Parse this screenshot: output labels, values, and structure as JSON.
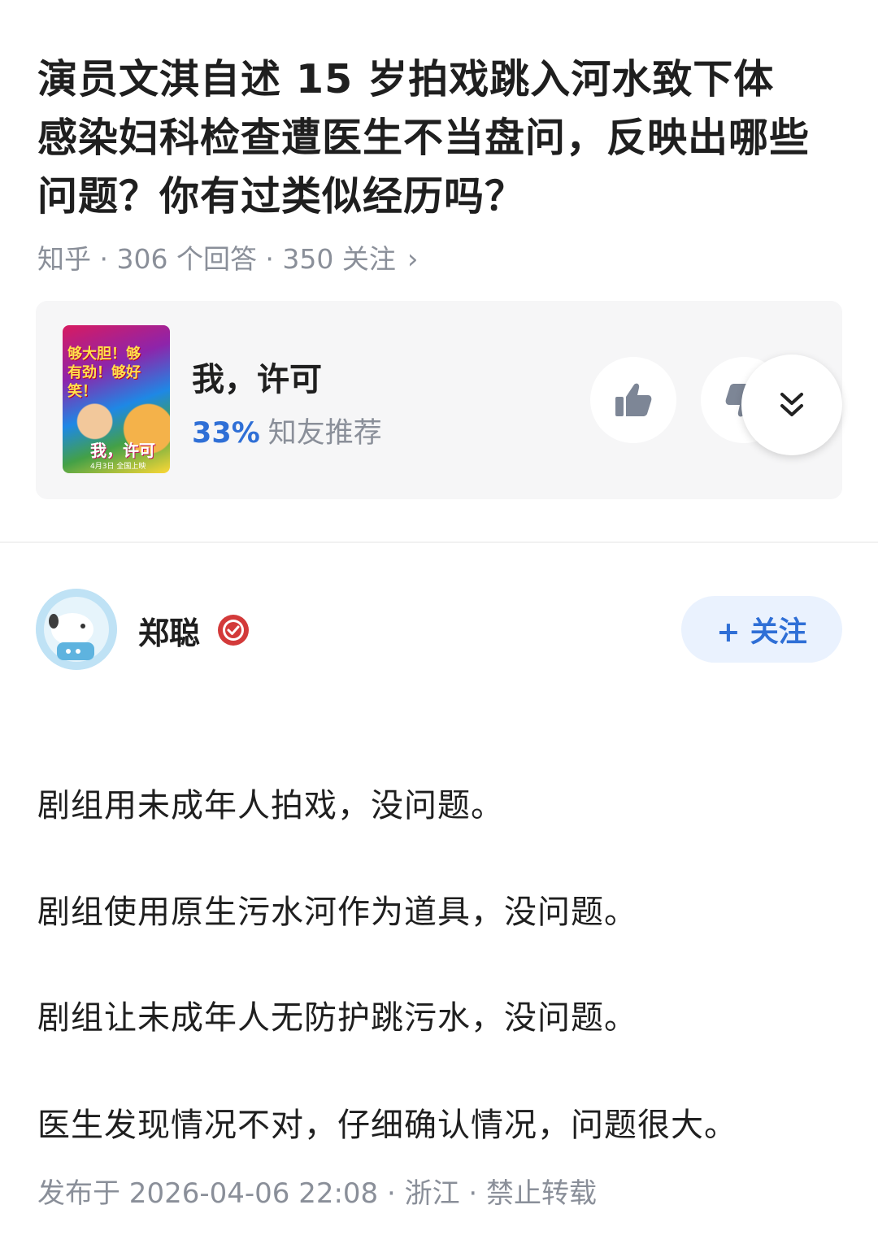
{
  "question": {
    "title_lines": [
      "演员文淇自述 15 岁拍戏跳入河水致下体",
      "感染妇科检查遭医生不当盘问，反映出哪些",
      "问题？你有过类似经历吗？"
    ],
    "meta": "知乎 · 306 个回答 · 350 关注",
    "meta_chevron": "›"
  },
  "movie_card": {
    "poster_text": "够大胆！够有劲！够好笑！",
    "poster_title": "我，许可",
    "poster_date": "4月3日 全国上映",
    "name": "我，许可",
    "recommend_pct": "33%",
    "recommend_label": "知友推荐",
    "icons": [
      "thumbs-up-icon",
      "thumbs-down-icon",
      "double-chevron-down-icon"
    ]
  },
  "author": {
    "name": "郑聪",
    "follow_label": "+ 关注",
    "icons": [
      "verified-badge-icon"
    ]
  },
  "answer": {
    "lines": [
      "剧组用未成年人拍戏，没问题。",
      "剧组使用原生污水河作为道具，没问题。",
      "剧组让未成年人无防护跳污水，没问题。",
      "医生发现情况不对，仔细确认情况，问题很大。"
    ],
    "meta": "发布于 2026-04-06 22:08 · 浙江 · 禁止转载"
  },
  "colors": {
    "accent_blue": "#2f6fd6",
    "meta_gray": "#8a8f99",
    "card_bg": "#f6f6f7",
    "follow_bg": "#eaf2fe",
    "badge_red": "#d33a3a"
  }
}
